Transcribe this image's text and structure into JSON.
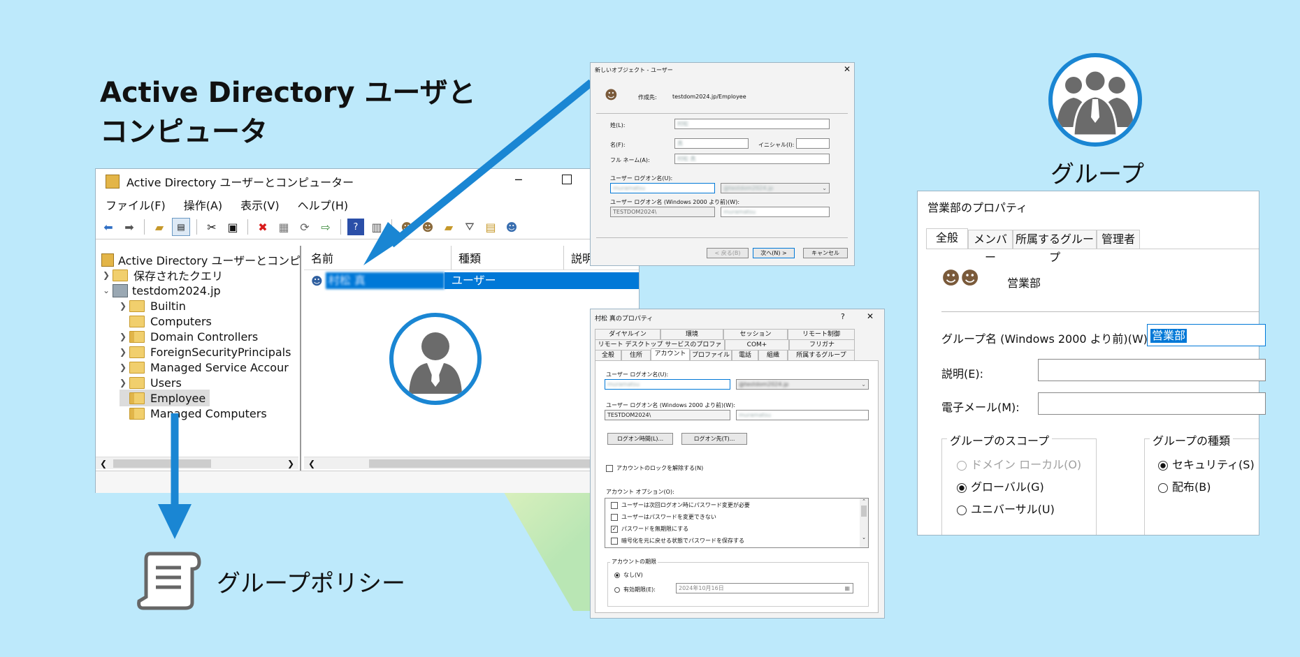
{
  "headline": {
    "line1": "Active Directory ユーザと",
    "line2": "コンピュータ"
  },
  "captions": {
    "group": "グループ",
    "group_policy": "グループポリシー"
  },
  "colors": {
    "background": "#bde9fb",
    "accent": "#1a86d3",
    "selection": "#0078d7",
    "icon_gray": "#6b6b6b"
  },
  "aduc": {
    "title": "Active Directory ユーザーとコンピューター",
    "menu": [
      "ファイル(F)",
      "操作(A)",
      "表示(V)",
      "ヘルプ(H)"
    ],
    "toolbar_icons": [
      "back-icon",
      "forward-icon",
      "up-folder-icon",
      "console-tree-icon",
      "cut-icon",
      "paste-icon",
      "delete-icon",
      "properties-icon",
      "refresh-icon",
      "export-icon",
      "help-icon",
      "mmc-icon",
      "new-user-icon",
      "new-group-icon",
      "new-ou-icon",
      "filter-icon",
      "find-icon",
      "add-to-group-icon"
    ],
    "tree": {
      "root": "Active Directory ユーザーとコンピュー",
      "saved_queries": "保存されたクエリ",
      "domain": "testdom2024.jp",
      "children": [
        "Builtin",
        "Computers",
        "Domain Controllers",
        "ForeignSecurityPrincipals",
        "Managed Service Accour",
        "Users",
        "Employee",
        "Managed Computers"
      ]
    },
    "list": {
      "columns": [
        "名前",
        "種類",
        "説明"
      ],
      "rows": [
        {
          "name": "村松 真",
          "type": "ユーザー"
        }
      ]
    }
  },
  "new_object": {
    "title": "新しいオブジェクト - ユーザー",
    "create_in_label": "作成先:",
    "create_in": "testdom2024.jp/Employee",
    "last_name_label": "姓(L):",
    "last_name": "村松",
    "first_name_label": "名(F):",
    "first_name": "真",
    "initials_label": "イニシャル(I):",
    "full_name_label": "フル ネーム(A):",
    "full_name": "村松 真",
    "logon_label": "ユーザー ログオン名(U):",
    "logon": "muramatsu",
    "domain_suffix": "@testdom2024.jp",
    "logon_pre2000_label": "ユーザー ログオン名 (Windows 2000 より前)(W):",
    "netbios": "TESTDOM2024\\",
    "logon_pre2000": "muramatsu",
    "btn_back": "< 戻る(B)",
    "btn_next": "次へ(N) >",
    "btn_cancel": "キャンセル"
  },
  "props": {
    "title": "村松 真のプロパティ",
    "help": "?",
    "tabs_row1": [
      "ダイヤルイン",
      "環境",
      "セッション",
      "リモート制御"
    ],
    "tabs_row2": [
      "リモート デスクトップ サービスのプロファイル",
      "COM+",
      "フリガナ"
    ],
    "tabs_row3": [
      "全般",
      "住所",
      "アカウント",
      "プロファイル",
      "電話",
      "組織",
      "所属するグループ"
    ],
    "logon_label": "ユーザー ログオン名(U):",
    "logon": "muramatsu",
    "domain_suffix": "@testdom2024.jp",
    "pre2000_label": "ユーザー ログオン名 (Windows 2000 より前)(W):",
    "netbios": "TESTDOM2024\\",
    "pre2000": "muramatsu",
    "btn_hours": "ログオン時間(L)...",
    "btn_logon_to": "ログオン先(T)...",
    "unlock": "アカウントのロックを解除する(N)",
    "options_label": "アカウント オプション(O):",
    "options": [
      {
        "text": "ユーザーは次回ログオン時にパスワード変更が必要",
        "checked": false
      },
      {
        "text": "ユーザーはパスワードを変更できない",
        "checked": false
      },
      {
        "text": "パスワードを無期限にする",
        "checked": true
      },
      {
        "text": "暗号化を元に戻せる状態でパスワードを保存する",
        "checked": false
      }
    ],
    "expiry_label": "アカウントの期限",
    "never": "なし(V)",
    "end_of": "有効期限(E):",
    "expiry_date": "2024年10月16日"
  },
  "group_props": {
    "title": "営業部のプロパティ",
    "tabs": [
      "全般",
      "メンバー",
      "所属するグループ",
      "管理者"
    ],
    "group_display": "営業部",
    "pre2000_label": "グループ名 (Windows 2000 より前)(W):",
    "pre2000_value": "営業部",
    "desc_label": "説明(E):",
    "email_label": "電子メール(M):",
    "scope_label": "グループのスコープ",
    "scope_options": [
      {
        "text": "ドメイン ローカル(O)",
        "selected": false,
        "disabled": true
      },
      {
        "text": "グローバル(G)",
        "selected": true,
        "disabled": false
      },
      {
        "text": "ユニバーサル(U)",
        "selected": false,
        "disabled": false
      }
    ],
    "type_label": "グループの種類",
    "type_options": [
      {
        "text": "セキュリティ(S)",
        "selected": true
      },
      {
        "text": "配布(B)",
        "selected": false
      }
    ]
  }
}
